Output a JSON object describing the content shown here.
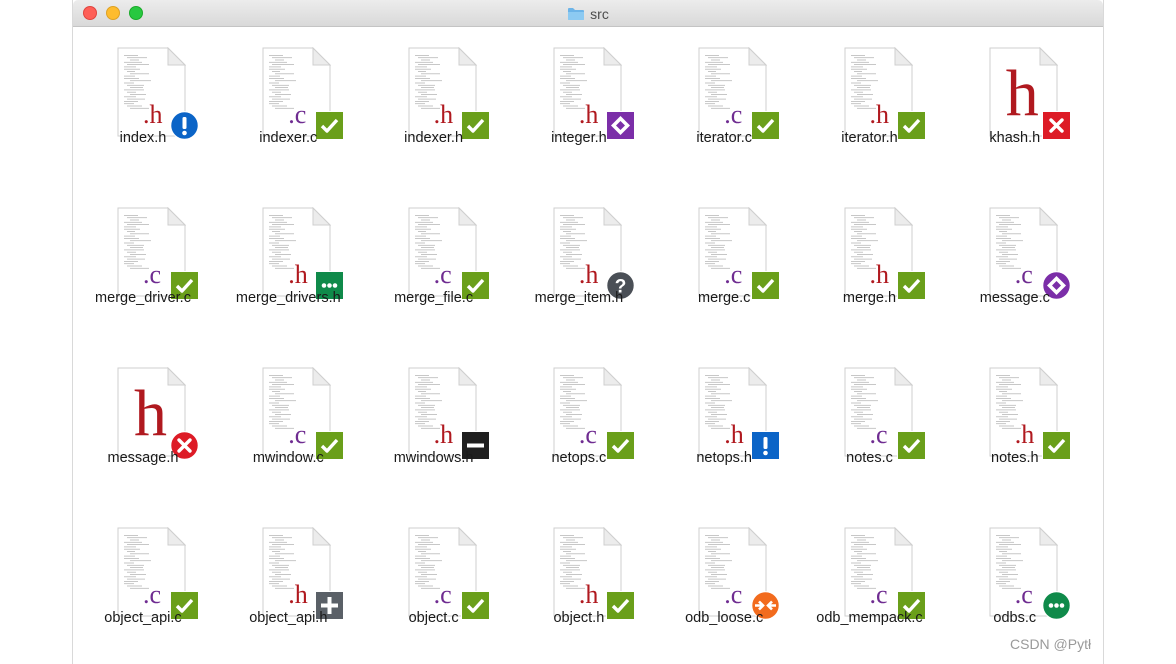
{
  "window": {
    "title": "src",
    "folder_icon": "folder-icon"
  },
  "watermark": "CSDN @Pytł",
  "colors": {
    "ok": "#6a9f1a",
    "warn_info": "#0b64c7",
    "conflict": "#dd1b26",
    "modified": "#7b2ea8",
    "added_dots": "#0f8a4a",
    "ignored": "#1f1f1f",
    "unknown": "#4a4f56",
    "add_gray": "#5a6067",
    "locked_orange": "#f26b1d",
    "c_ext": "#6f2c91",
    "h_ext": "#b0191f"
  },
  "files": [
    {
      "name": "index.h",
      "ext": ".h",
      "badge": "exclamation-circle"
    },
    {
      "name": "indexer.c",
      "ext": ".c",
      "badge": "check"
    },
    {
      "name": "indexer.h",
      "ext": ".h",
      "badge": "check"
    },
    {
      "name": "integer.h",
      "ext": ".h",
      "badge": "diamond-square"
    },
    {
      "name": "iterator.c",
      "ext": ".c",
      "badge": "check"
    },
    {
      "name": "iterator.h",
      "ext": ".h",
      "badge": "check"
    },
    {
      "name": "khash.h",
      "ext": "h",
      "badge": "x-square",
      "big": true
    },
    {
      "name": "merge_driver.c",
      "ext": ".c",
      "badge": "check"
    },
    {
      "name": "merge_drivers.h",
      "ext": ".h",
      "badge": "dots-square"
    },
    {
      "name": "merge_file.c",
      "ext": ".c",
      "badge": "check"
    },
    {
      "name": "merge_item.h",
      "ext": ".h",
      "badge": "question-circle"
    },
    {
      "name": "merge.c",
      "ext": ".c",
      "badge": "check"
    },
    {
      "name": "merge.h",
      "ext": ".h",
      "badge": "check"
    },
    {
      "name": "message.c",
      "ext": ".c",
      "badge": "diamond-circle"
    },
    {
      "name": "message.h",
      "ext": "h",
      "badge": "x-circle",
      "big": true
    },
    {
      "name": "mwindow.c",
      "ext": ".c",
      "badge": "check"
    },
    {
      "name": "mwindows.h",
      "ext": ".h",
      "badge": "minus-square"
    },
    {
      "name": "netops.c",
      "ext": ".c",
      "badge": "check"
    },
    {
      "name": "netops.h",
      "ext": ".h",
      "badge": "exclamation-square"
    },
    {
      "name": "notes.c",
      "ext": ".c",
      "badge": "check"
    },
    {
      "name": "notes.h",
      "ext": ".h",
      "badge": "check"
    },
    {
      "name": "object_api.c",
      "ext": ".c",
      "badge": "check"
    },
    {
      "name": "object_api.h",
      "ext": ".h",
      "badge": "plus-square"
    },
    {
      "name": "object.c",
      "ext": ".c",
      "badge": "check"
    },
    {
      "name": "object.h",
      "ext": ".h",
      "badge": "check"
    },
    {
      "name": "odb_loose.c",
      "ext": ".c",
      "badge": "arrows-circle"
    },
    {
      "name": "odb_mempack.c",
      "ext": ".c",
      "badge": "check"
    },
    {
      "name": "odbs.c",
      "ext": ".c",
      "badge": "dots-circle"
    }
  ]
}
